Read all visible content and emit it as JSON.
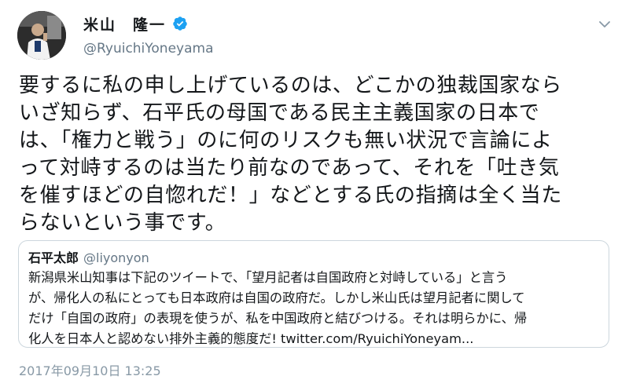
{
  "author": {
    "display_name": "米山　隆一",
    "handle": "@RyuichiYoneyama",
    "verified_color": "#1da1f2"
  },
  "tweet": {
    "lines": [
      "要するに私の申し上げているのは、どこかの独裁国家なら",
      "いざ知らず、石平氏の母国である民主主義国家の日本で",
      "は、「権力と戦う」のに何のリスクも無い状況で言論によ",
      "って対峙するのは当たり前なのであって、それを「吐き気",
      "を催すほどの自惚れだ！」などとする氏の指摘は全く当た",
      "らないという事です。"
    ]
  },
  "quote": {
    "display_name": "石平太郎",
    "handle": "@liyonyon",
    "lines": [
      "新潟県米山知事は下記のツイートで、「望月記者は自国政府と対峙している」と言う",
      "が、帰化人の私にとっても日本政府は自国の政府だ。しかし米山氏は望月記者に関して",
      "だけ「自国の政府」の表現を使うが、私を中国政府と結びつける。それは明らかに、帰",
      "化人を日本人と認めない排外主義的態度だ! twitter.com/RyuichiYoneyam..."
    ]
  },
  "timestamp": "2017年09月10日 13:25",
  "icons": {
    "avatar": "profile-photo",
    "verified": "verified-badge-icon",
    "menu": "chevron-down-icon"
  }
}
